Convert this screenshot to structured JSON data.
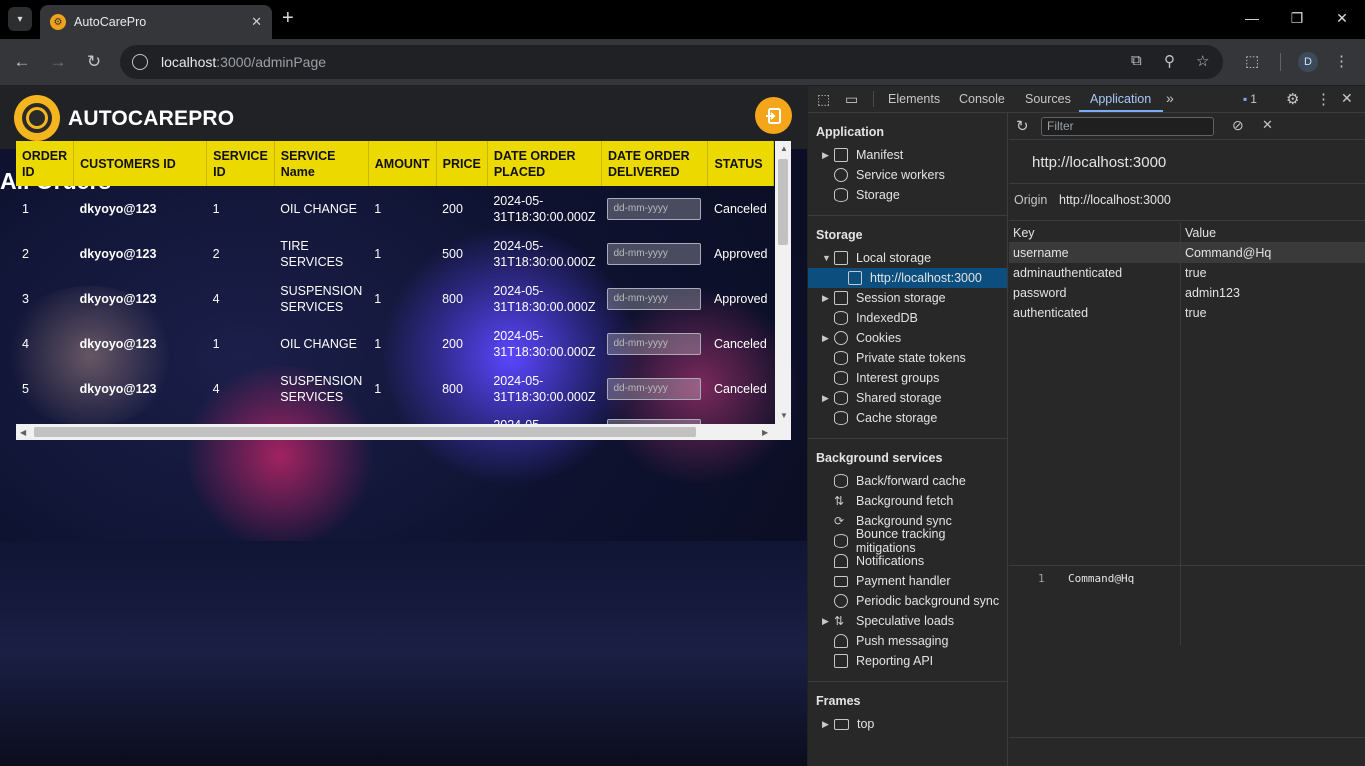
{
  "browser": {
    "tab_title": "AutoCarePro",
    "url_host": "localhost",
    "url_rest": ":3000/adminPage",
    "profile_initial": "D"
  },
  "page": {
    "brand": "AUTOCAREPRO",
    "title": "All Orders",
    "table": {
      "headers": [
        "ORDER ID",
        "CUSTOMERS ID",
        "SERVICE ID",
        "SERVICE Name",
        "AMOUNT",
        "PRICE",
        "DATE ORDER PLACED",
        "DATE ORDER DELIVERED",
        "STATUS"
      ],
      "date_placeholder": "dd-mm-yyyy",
      "rows": [
        {
          "order_id": "1",
          "customer": "dkyoyo@123",
          "service_id": "1",
          "service_name": "OIL CHANGE",
          "amount": "1",
          "price": "200",
          "placed": "2024-05-31T18:30:00.000Z",
          "status": "Canceled"
        },
        {
          "order_id": "2",
          "customer": "dkyoyo@123",
          "service_id": "2",
          "service_name": "TIRE SERVICES",
          "amount": "1",
          "price": "500",
          "placed": "2024-05-31T18:30:00.000Z",
          "status": "Approved"
        },
        {
          "order_id": "3",
          "customer": "dkyoyo@123",
          "service_id": "4",
          "service_name": "SUSPENSION SERVICES",
          "amount": "1",
          "price": "800",
          "placed": "2024-05-31T18:30:00.000Z",
          "status": "Approved"
        },
        {
          "order_id": "4",
          "customer": "dkyoyo@123",
          "service_id": "1",
          "service_name": "OIL CHANGE",
          "amount": "1",
          "price": "200",
          "placed": "2024-05-31T18:30:00.000Z",
          "status": "Canceled"
        },
        {
          "order_id": "5",
          "customer": "dkyoyo@123",
          "service_id": "4",
          "service_name": "SUSPENSION SERVICES",
          "amount": "1",
          "price": "800",
          "placed": "2024-05-31T18:30:00.000Z",
          "status": "Canceled"
        }
      ],
      "partial_row_placed": "2024-05-"
    }
  },
  "devtools": {
    "tabs": [
      "Elements",
      "Console",
      "Sources",
      "Application"
    ],
    "active_tab": "Application",
    "issues_count": "1",
    "application_section": "Application",
    "application_items": [
      "Manifest",
      "Service workers",
      "Storage"
    ],
    "storage_section": "Storage",
    "storage_items": [
      "Local storage",
      "http://localhost:3000",
      "Session storage",
      "IndexedDB",
      "Cookies",
      "Private state tokens",
      "Interest groups",
      "Shared storage",
      "Cache storage"
    ],
    "background_section": "Background services",
    "background_items": [
      "Back/forward cache",
      "Background fetch",
      "Background sync",
      "Bounce tracking mitigations",
      "Notifications",
      "Payment handler",
      "Periodic background sync",
      "Speculative loads",
      "Push messaging",
      "Reporting API"
    ],
    "frames_section": "Frames",
    "frames_items": [
      "top"
    ],
    "filter_placeholder": "Filter",
    "origin_heading": "http://localhost:3000",
    "origin_label": "Origin",
    "origin_value": "http://localhost:3000",
    "kv_header_key": "Key",
    "kv_header_value": "Value",
    "kv_rows": [
      {
        "key": "username",
        "value": "Command@Hq"
      },
      {
        "key": "adminauthenticated",
        "value": "true"
      },
      {
        "key": "password",
        "value": "admin123"
      },
      {
        "key": "authenticated",
        "value": "true"
      }
    ],
    "preview_line_number": "1",
    "preview_value": "Command@Hq"
  },
  "colors": {
    "accent_yellow": "#ecd900",
    "logo_orange": "#f4b51f",
    "devtools_selection": "#0c4f7e"
  }
}
